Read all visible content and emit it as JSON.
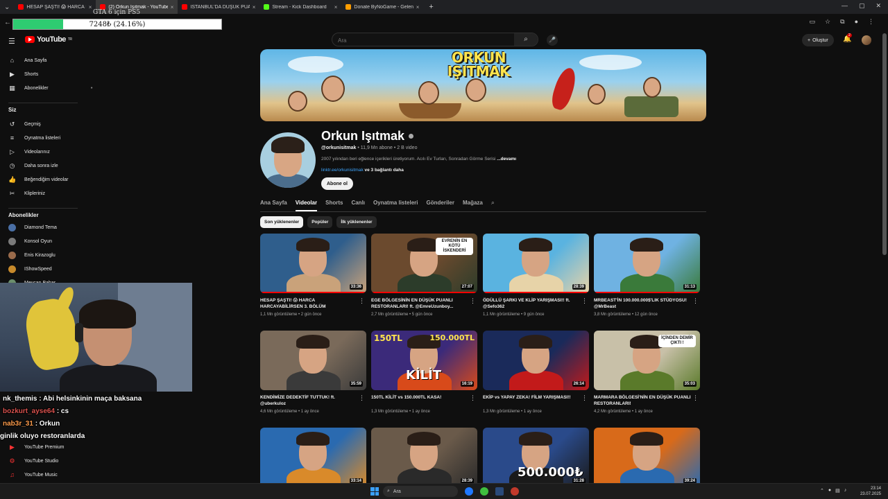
{
  "browser": {
    "tabs": [
      {
        "title": "HESAP ŞAŞTI! 😱 HARCA HARC...",
        "favicon_color": "#ff0000",
        "active": false
      },
      {
        "title": "(2) Orkun Işıtmak - YouTube",
        "favicon_color": "#ff0000",
        "active": true
      },
      {
        "title": "İSTANBUL'DA DÜŞÜK PUANLI RE...",
        "favicon_color": "#ff0000",
        "active": false
      },
      {
        "title": "Stream - Kick Dashboard",
        "favicon_color": "#53fc18",
        "active": false
      },
      {
        "title": "Donate ByNoGame - Gelen/Gide...",
        "favicon_color": "#ff9d00",
        "active": false
      }
    ],
    "close_glyph": "×",
    "new_tab_glyph": "+",
    "window_controls": [
      "—",
      "▢",
      "✕"
    ],
    "overlay_gta": "GTA 6 için PS5",
    "progress": {
      "text": "7248₺ (24.16%)",
      "percent": 24.16,
      "color": "#2ecc71"
    }
  },
  "header": {
    "logo_text": "YouTube",
    "logo_region": "TR",
    "search_placeholder": "Ara",
    "create_label": "Oluştur",
    "notification_count": "2"
  },
  "sidebar": {
    "main": [
      {
        "label": "Ana Sayfa",
        "icon": "home-icon"
      },
      {
        "label": "Shorts",
        "icon": "shorts-icon"
      },
      {
        "label": "Abonelikler",
        "icon": "subscriptions-icon"
      }
    ],
    "you_label": "Siz",
    "you": [
      {
        "label": "Geçmiş",
        "icon": "history-icon"
      },
      {
        "label": "Oynatma listeleri",
        "icon": "playlist-icon"
      },
      {
        "label": "Videolarınız",
        "icon": "your-videos-icon"
      },
      {
        "label": "Daha sonra izle",
        "icon": "watch-later-icon"
      },
      {
        "label": "Beğendiğim videolar",
        "icon": "liked-icon"
      },
      {
        "label": "Klipleriniz",
        "icon": "clips-icon"
      }
    ],
    "subs_label": "Abonelikler",
    "subs": [
      {
        "label": "Diamond Tema",
        "color": "#4a6fa5"
      },
      {
        "label": "Konsol Oyun",
        "color": "#7a7a7a"
      },
      {
        "label": "Enis Kirazoglu",
        "color": "#9a6b4b"
      },
      {
        "label": "IShowSpeed",
        "color": "#c78a2b"
      },
      {
        "label": "Meycan Bahar",
        "color": "#6b8e6b"
      }
    ],
    "bottom": [
      {
        "label": "YouTube Premium",
        "icon": "premium-icon"
      },
      {
        "label": "YouTube Studio",
        "icon": "studio-icon"
      },
      {
        "label": "YouTube Music",
        "icon": "music-icon"
      }
    ]
  },
  "chat": [
    {
      "user": "nk_themis",
      "text": " : Abi helsinkinin maça baksana",
      "color": "#ffffff"
    },
    {
      "user": "bozkurt_ayse64",
      "text": " : cs",
      "color": "#d9534f"
    },
    {
      "user": "nab3r_31",
      "text": " : Orkun",
      "color": "#ff9d4d"
    },
    {
      "user": "",
      "text": "ginlik oluyo restoranlarda",
      "color": "#ffffff"
    }
  ],
  "banner": {
    "title": "ORKUN IŞITMAK"
  },
  "channel": {
    "name": "Orkun Işıtmak",
    "handle": "@orkunisitmak",
    "stats": " • 11,9 Mn abone • 2 B video",
    "description": "2007 yılından beri eğlence içerikleri üretiyorum. Acılı Ev Turları, Sonradan Görme Serisi",
    "more": " ...devamı",
    "link": "linktr.ee/orkunisitmak",
    "link_rest": " ve 3 bağlantı daha",
    "subscribe_label": "Abone ol"
  },
  "tabs": [
    "Ana Sayfa",
    "Videolar",
    "Shorts",
    "Canlı",
    "Oynatma listeleri",
    "Gönderiler",
    "Mağaza"
  ],
  "active_tab": 1,
  "chips": [
    "Son yüklenenler",
    "Popüler",
    "İlk yüklenenler"
  ],
  "videos": [
    {
      "title": "HESAP ŞAŞTI! 😱 HARCA HARCAYABİLİRSEN 3. BÖLÜM",
      "meta": "1,1 Mn görüntüleme • 2 gün önce",
      "duration": "33:36",
      "watched": 1.0,
      "bg": "#2f5e8c",
      "bg2": "#c9a27a"
    },
    {
      "title": "EGE BÖLGESİNİN EN DÜŞÜK PUANLI RESTORANLARI! ft. @EmreUzunboy...",
      "meta": "2,7 Mn görüntüleme • 5 gün önce",
      "duration": "27:07",
      "watched": 1.0,
      "bg": "#6b4a2e",
      "bg2": "#2c3c2a",
      "box": "EVRENİN EN KÖTÜ İSKENDERİ"
    },
    {
      "title": "ÖDÜLLÜ ŞARKI VE KLİP YARIŞMASI!! ft. @Sefo362",
      "meta": "1,1 Mn görüntüleme • 9 gün önce",
      "duration": "28:39",
      "watched": 1.0,
      "bg": "#5ab3e0",
      "bg2": "#e7d3a8"
    },
    {
      "title": "MRBEAST'İN 100.000.000$'LIK STÜDYOSU! @MrBeast",
      "meta": "3,8 Mn görüntüleme • 12 gün önce",
      "duration": "31:13",
      "watched": 1.0,
      "bg": "#6fb2e2",
      "bg2": "#3a7a3a"
    },
    {
      "title": "KENDİMİZE DEDEKTİF TUTTUK! ft. @uberkuloz",
      "meta": "4,6 Mn görüntüleme • 1 ay önce",
      "duration": "35:59",
      "watched": 0.0,
      "bg": "#7a6a5a",
      "bg2": "#3a3a3a"
    },
    {
      "title": "150TL KİLİT vs 150.000TL KASA!",
      "meta": "1,3 Mn görüntüleme • 1 ay önce",
      "duration": "16:19",
      "watched": 0.0,
      "bg": "#3b2a7a",
      "bg2": "#d84a1a",
      "big_left": "150TL",
      "big_right": "150.000TL",
      "mid": "KİLİT"
    },
    {
      "title": "EKİP vs YAPAY ZEKA! FİLM YARIŞMASI!!",
      "meta": "1,3 Mn görüntüleme • 1 ay önce",
      "duration": "26:14",
      "watched": 0.0,
      "bg": "#1a2a5a",
      "bg2": "#c21a1a"
    },
    {
      "title": "MARMARA BÖLGESİ'NİN EN DÜŞÜK PUANLI RESTORANLARI!",
      "meta": "4,2 Mn görüntüleme • 1 ay önce",
      "duration": "35:03",
      "watched": 0.0,
      "bg": "#c8c0a8",
      "bg2": "#5a7a2a",
      "box": "İÇİNDEN DEMİR ÇIKTI !"
    },
    {
      "title": "",
      "meta": "",
      "duration": "33:14",
      "watched": 0.0,
      "bg": "#2a6ab0",
      "bg2": "#d98a2a"
    },
    {
      "title": "",
      "meta": "",
      "duration": "28:39",
      "watched": 0.0,
      "bg": "#6a5a4a",
      "bg2": "#2a2a2a"
    },
    {
      "title": "",
      "meta": "",
      "duration": "31:28",
      "watched": 0.0,
      "bg": "#2a4a8a",
      "bg2": "#1a1a1a",
      "mid": "500.000₺"
    },
    {
      "title": "",
      "meta": "",
      "duration": "39:24",
      "watched": 0.0,
      "bg": "#d86a1a",
      "bg2": "#2a6ab0"
    }
  ],
  "taskbar": {
    "search_label": "Ara",
    "time": "23:14",
    "date": "23.07.2025"
  }
}
